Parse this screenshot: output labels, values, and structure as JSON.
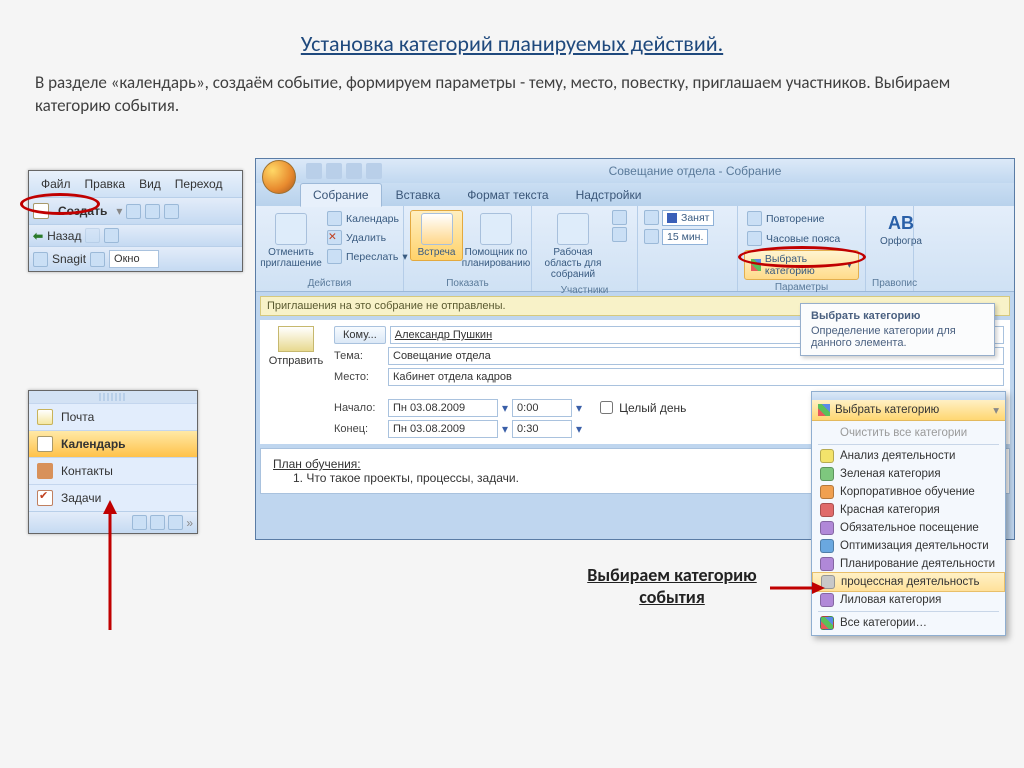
{
  "slide": {
    "title": "Установка категорий планируемых действий.",
    "description": "В разделе «календарь», создаём событие, формируем параметры  - тему, место, повестку, приглашаем участников. Выбираем категорию события."
  },
  "snippet1": {
    "menu": {
      "file": "Файл",
      "edit": "Правка",
      "view": "Вид",
      "go": "Переход"
    },
    "create": "Создать",
    "back": "Назад",
    "snagit": "Snagit",
    "window": "Окно"
  },
  "nav": {
    "mail": "Почта",
    "calendar": "Календарь",
    "contacts": "Контакты",
    "tasks": "Задачи"
  },
  "window": {
    "title": "Совещание отдела - Собрание",
    "tabs": {
      "meeting": "Собрание",
      "insert": "Вставка",
      "format": "Формат текста",
      "addins": "Надстройки"
    },
    "ribbon": {
      "actions_group": "Действия",
      "cancel_label": "Отменить приглашение",
      "calendar": "Календарь",
      "delete": "Удалить",
      "forward": "Переслать",
      "show_group": "Показать",
      "appointment": "Встреча",
      "scheduling": "Помощник по планированию",
      "attendees_group": "Участники",
      "workspace": "Рабочая область для собраний",
      "options_group": "Параметры",
      "busy": "Занят",
      "reminder": "15 мин.",
      "recurrence": "Повторение",
      "timezones": "Часовые пояса",
      "categorize": "Выбрать категорию",
      "spelling_group": "Правопис",
      "spelling": "Орфогра"
    },
    "info": "Приглашения на это собрание не отправлены.",
    "form": {
      "send": "Отправить",
      "to_btn": "Кому...",
      "to_val": "Александр Пушкин",
      "subject_lbl": "Тема:",
      "subject_val": "Совещание отдела",
      "location_lbl": "Место:",
      "location_val": "Кабинет отдела кадров",
      "start_lbl": "Начало:",
      "end_lbl": "Конец:",
      "date": "Пн 03.08.2009",
      "t_start": "0:00",
      "t_end": "0:30",
      "allday": "Целый день"
    },
    "body": {
      "title": "План обучения:",
      "item": "1.    Что такое проекты, процессы, задачи."
    }
  },
  "tooltip": {
    "title": "Выбрать категорию",
    "desc": "Определение категории для данного элемента."
  },
  "dropdown": {
    "header": "Выбрать категорию",
    "clear": "Очистить все категории",
    "items": [
      {
        "label": "Анализ деятельности",
        "color": "#f3e36b"
      },
      {
        "label": "Зеленая категория",
        "color": "#7ec77e"
      },
      {
        "label": "Корпоративное обучение",
        "color": "#f0a050"
      },
      {
        "label": "Красная категория",
        "color": "#e06a6a"
      },
      {
        "label": "Обязательное посещение",
        "color": "#b088d8"
      },
      {
        "label": "Оптимизация деятельности",
        "color": "#6aa8e0"
      },
      {
        "label": "Планирование деятельности",
        "color": "#b088d8"
      },
      {
        "label": "процессная деятельность",
        "color": "#c8c8c8"
      },
      {
        "label": "Лиловая категория",
        "color": "#b088d8"
      }
    ],
    "all": "Все категории…"
  },
  "annotations": {
    "choose": "Выбираем категорию события"
  }
}
